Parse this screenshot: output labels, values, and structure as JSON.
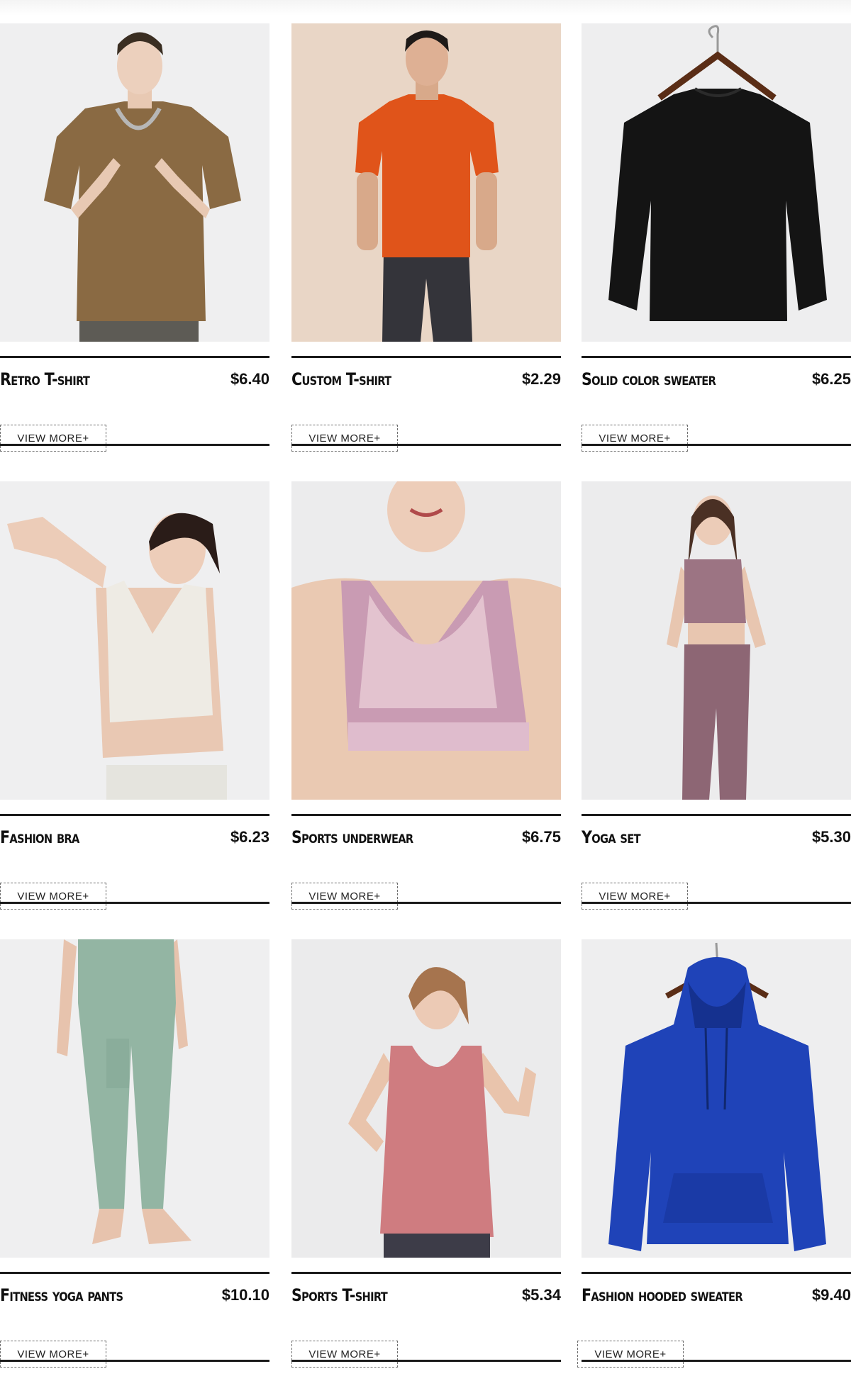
{
  "products": [
    {
      "name": "Retro T-shirt",
      "price": "$6.40",
      "button": "VIEW MORE+",
      "image": "retro-tshirt-photo"
    },
    {
      "name": "Custom T-shirt",
      "price": "$2.29",
      "button": "VIEW MORE+",
      "image": "custom-tshirt-photo"
    },
    {
      "name": "Solid color sweater",
      "price": "$6.25",
      "button": "VIEW MORE+",
      "image": "solid-sweater-photo"
    },
    {
      "name": "Fashion bra",
      "price": "$6.23",
      "button": "VIEW MORE+",
      "image": "fashion-bra-photo"
    },
    {
      "name": "Sports underwear",
      "price": "$6.75",
      "button": "VIEW MORE+",
      "image": "sports-underwear-photo"
    },
    {
      "name": "Yoga set",
      "price": "$5.30",
      "button": "VIEW MORE+",
      "image": "yoga-set-photo"
    },
    {
      "name": "Fitness yoga pants",
      "price": "$10.10",
      "button": "VIEW MORE+",
      "image": "yoga-pants-photo"
    },
    {
      "name": "Sports T-shirt",
      "price": "$5.34",
      "button": "VIEW MORE+",
      "image": "sports-tshirt-photo"
    },
    {
      "name": "Fashion hooded sweater",
      "price": "$9.40",
      "button": "VIEW MORE+",
      "image": "hoodie-photo"
    }
  ],
  "colors": {
    "rule": "#1b1b1b",
    "text": "#111111",
    "button_border": "#6e6e6e",
    "photo_background_light": "#eeeeef",
    "photo_background_warm": "#e9d9cc"
  }
}
